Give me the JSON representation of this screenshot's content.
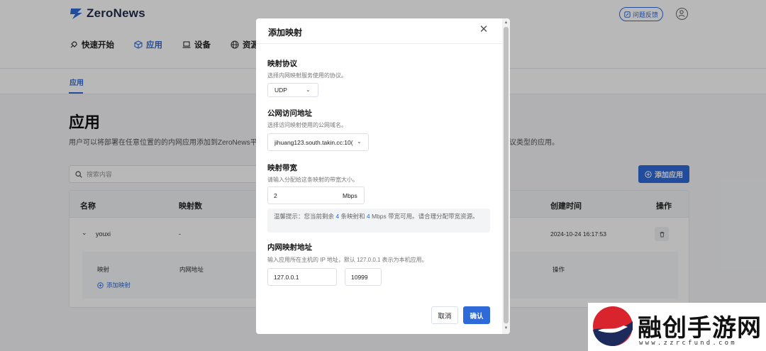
{
  "app": {
    "brand": "ZeroNews",
    "feedback_label": "问题反馈"
  },
  "nav": {
    "items": [
      {
        "label": "快速开始",
        "icon": "rocket-icon"
      },
      {
        "label": "应用",
        "icon": "cube-icon",
        "active": true
      },
      {
        "label": "设备",
        "icon": "laptop-icon"
      },
      {
        "label": "资源",
        "icon": "globe-icon"
      }
    ]
  },
  "subnav": {
    "tab": "应用"
  },
  "page": {
    "title": "应用",
    "description": "用户可以将部署在任意位置的的内网应用添加到ZeroNews平",
    "description_tail": "议类型的应用。",
    "search_placeholder": "搜索内容",
    "add_button": "添加应用"
  },
  "table": {
    "headers": [
      "名称",
      "映射数",
      "创建时间",
      "操作"
    ],
    "rows": [
      {
        "name": "youxi",
        "mappings": "-",
        "created": "2024-10-24 16:17:53"
      }
    ],
    "sub_headers": [
      "映射",
      "内网地址",
      "操作"
    ],
    "add_mapping": "添加映射"
  },
  "modal": {
    "title": "添加映射",
    "protocol": {
      "label": "映射协议",
      "hint": "选择内网映射服务使用的协议。",
      "value": "UDP"
    },
    "domain": {
      "label": "公网访问地址",
      "hint": "选择访问映射使用的公网域名。",
      "value": "jihuang123.south.takin.cc:10("
    },
    "bandwidth": {
      "label": "映射带宽",
      "hint": "请输入分配给这条映射的带宽大小。",
      "value": "2",
      "unit": "Mbps"
    },
    "tip": {
      "prefix": "温馨提示：您当前剩余",
      "count": "4",
      "middle": "条映射和",
      "bandwidth": "4",
      "suffix": "Mbps 带宽可用。请合理分配带宽资源。"
    },
    "internal": {
      "label": "内网映射地址",
      "hint": "输入应用所在主机的 IP 地址，默认 127.0.0.1 表示为本机应用。",
      "ip": "127.0.0.1",
      "port": "10999"
    },
    "cancel": "取消",
    "confirm": "确认"
  },
  "watermark": {
    "title": "融创手游网",
    "url": "www.zzrcfund.com"
  },
  "colors": {
    "accent": "#2f6bd8",
    "watermark_red": "#d9232d",
    "watermark_navy": "#1c2a5c"
  }
}
